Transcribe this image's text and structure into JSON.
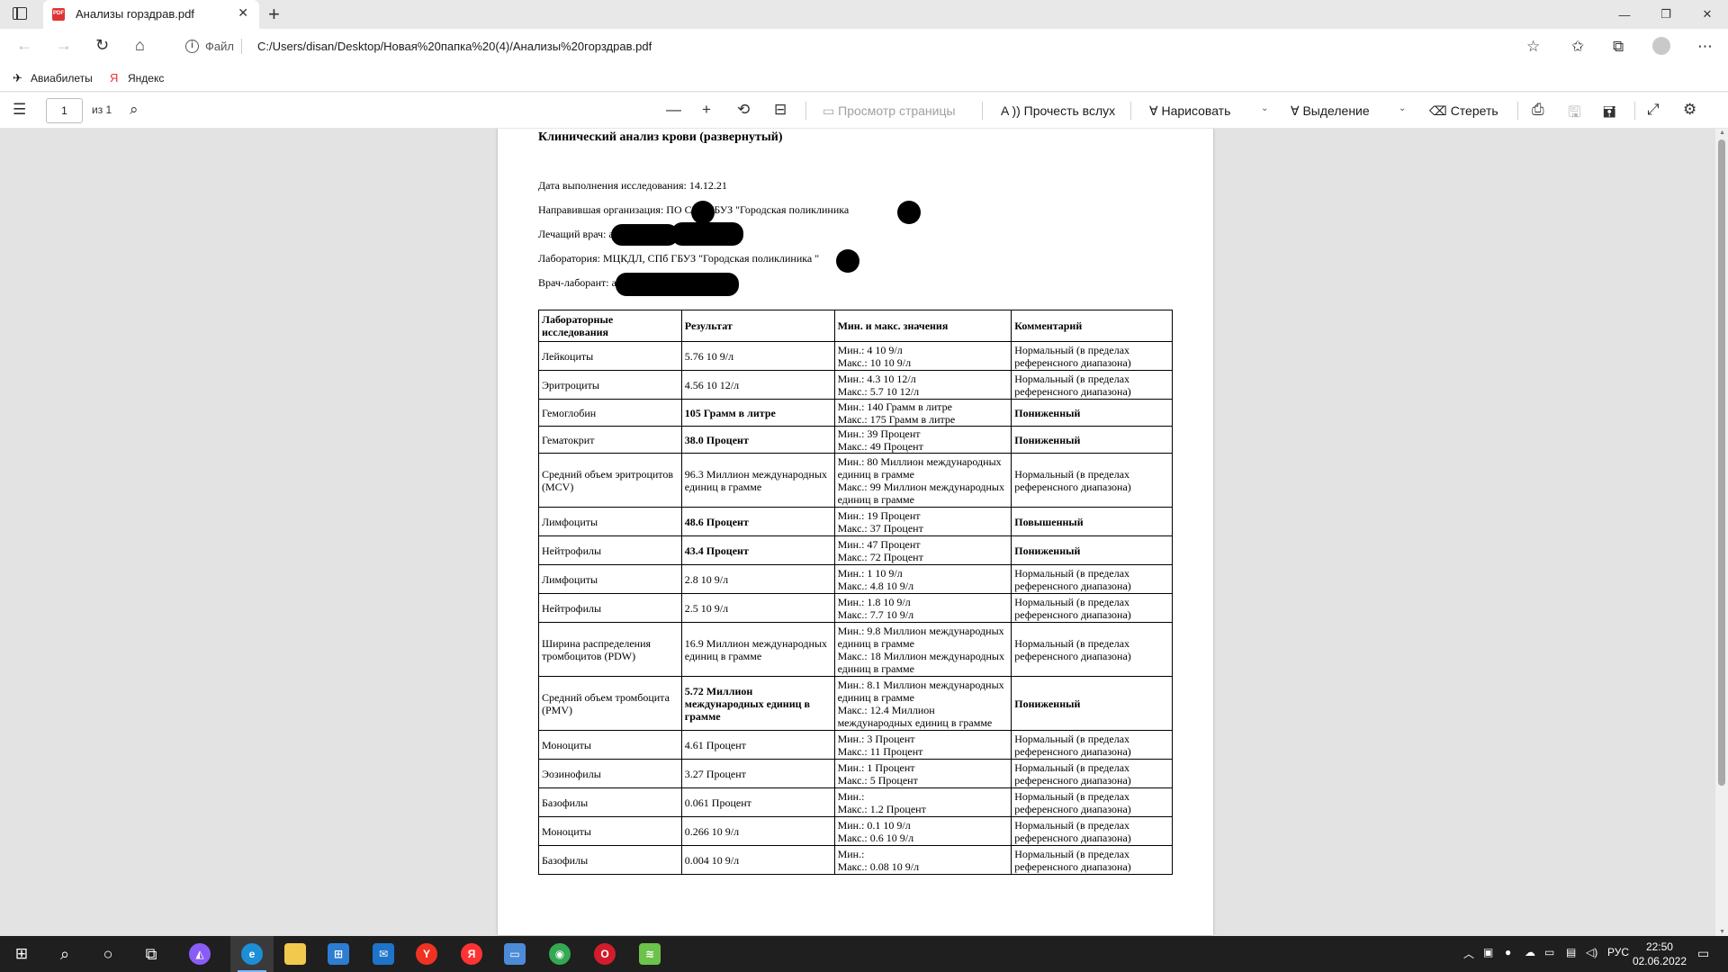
{
  "browser": {
    "tab_title": "Анализы горздрав.pdf",
    "address_label": "Файл",
    "url": "C:/Users/disan/Desktop/Новая%20папка%20(4)/Анализы%20горздрав.pdf",
    "bookmarks": [
      "Авиабилеты",
      "Яндекс"
    ]
  },
  "pdf_toolbar": {
    "page_number": "1",
    "page_of": "из 1",
    "page_view": "Просмотр страницы",
    "read_aloud": "Прочесть вслух",
    "draw": "Нарисовать",
    "highlight": "Выделение",
    "erase": "Стереть"
  },
  "document": {
    "title": "Клинический анализ крови (развернутый)",
    "meta": [
      "Дата выполнения исследования: 14.12.21",
      "Направившая организация: ПО     СПб ГБУЗ \"Городская поликлиника",
      "Лечащий врач:                                       а",
      "Лаборатория: МЦКДЛ, СПб ГБУЗ \"Городская поликлиника      \"",
      "Врач-лаборант:                                      а"
    ],
    "table": {
      "headers": [
        "Лабораторные исследования",
        "Результат",
        "Мин. и макс. значения",
        "Комментарий"
      ],
      "rows": [
        {
          "name": "Лейкоциты",
          "result": "5.76 10 9/л",
          "range": "Мин.: 4 10 9/л\nМакс.: 10 10 9/л",
          "comment": "Нормальный (в пределах референсного диапазона)",
          "bold": false
        },
        {
          "name": "Эритроциты",
          "result": "4.56 10 12/л",
          "range": "Мин.: 4.3 10 12/л\nМакс.: 5.7 10 12/л",
          "comment": "Нормальный (в пределах референсного диапазона)",
          "bold": false
        },
        {
          "name": "Гемоглобин",
          "result": "105 Грамм в литре",
          "range": "Мин.: 140 Грамм в литре\nМакс.: 175 Грамм в литре",
          "comment": "Пониженный",
          "bold": true
        },
        {
          "name": "Гематокрит",
          "result": "38.0 Процент",
          "range": "Мин.: 39 Процент\nМакс.: 49 Процент",
          "comment": "Пониженный",
          "bold": true
        },
        {
          "name": "Средний объем эритроцитов (MCV)",
          "result": "96.3 Миллион международных единиц в грамме",
          "range": "Мин.: 80 Миллион международных единиц в грамме\nМакс.: 99 Миллион международных единиц в грамме",
          "comment": "Нормальный (в пределах референсного диапазона)",
          "bold": false
        },
        {
          "name": "Лимфоциты",
          "result": "48.6 Процент",
          "range": "Мин.: 19 Процент\nМакс.: 37 Процент",
          "comment": "Повышенный",
          "bold": true
        },
        {
          "name": "Нейтрофилы",
          "result": "43.4 Процент",
          "range": "Мин.: 47 Процент\nМакс.: 72 Процент",
          "comment": "Пониженный",
          "bold": true
        },
        {
          "name": "Лимфоциты",
          "result": "2.8 10 9/л",
          "range": "Мин.: 1 10 9/л\nМакс.: 4.8 10 9/л",
          "comment": "Нормальный (в пределах референсного диапазона)",
          "bold": false
        },
        {
          "name": "Нейтрофилы",
          "result": "2.5 10 9/л",
          "range": "Мин.: 1.8 10 9/л\nМакс.: 7.7 10 9/л",
          "comment": "Нормальный (в пределах референсного диапазона)",
          "bold": false
        },
        {
          "name": "Ширина распределения тромбоцитов (PDW)",
          "result": "16.9 Миллион международных единиц в грамме",
          "range": "Мин.: 9.8 Миллион международных единиц в грамме\nМакс.: 18 Миллион международных единиц в грамме",
          "comment": "Нормальный (в пределах референсного диапазона)",
          "bold": false
        },
        {
          "name": "Средний объем тромбоцита (PMV)",
          "result": "5.72 Миллион международных единиц в грамме",
          "range": "Мин.: 8.1 Миллион международных единиц в грамме\nМакс.: 12.4 Миллион международных единиц в грамме",
          "comment": "Пониженный",
          "bold": true
        },
        {
          "name": "Моноциты",
          "result": "4.61 Процент",
          "range": "Мин.: 3 Процент\nМакс.: 11 Процент",
          "comment": "Нормальный (в пределах референсного диапазона)",
          "bold": false
        },
        {
          "name": "Эозинофилы",
          "result": "3.27 Процент",
          "range": "Мин.: 1 Процент\nМакс.: 5 Процент",
          "comment": "Нормальный (в пределах референсного диапазона)",
          "bold": false
        },
        {
          "name": "Базофилы",
          "result": "0.061 Процент",
          "range": "Мин.:\nМакс.: 1.2 Процент",
          "comment": "Нормальный (в пределах референсного диапазона)",
          "bold": false
        },
        {
          "name": "Моноциты",
          "result": "0.266 10 9/л",
          "range": "Мин.: 0.1 10 9/л\nМакс.: 0.6 10 9/л",
          "comment": "Нормальный (в пределах референсного диапазона)",
          "bold": false
        },
        {
          "name": "Базофилы",
          "result": "0.004 10 9/л",
          "range": "Мин.:\nМакс.: 0.08 10 9/л",
          "comment": "Нормальный (в пределах референсного диапазона)",
          "bold": false
        }
      ]
    }
  },
  "taskbar": {
    "lang": "РУС",
    "time": "22:50",
    "date": "02.06.2022"
  },
  "colors": {
    "accent": "#0078d4",
    "taskbar": "#1f1f1f",
    "viewer_bg": "#e3e3e3"
  }
}
